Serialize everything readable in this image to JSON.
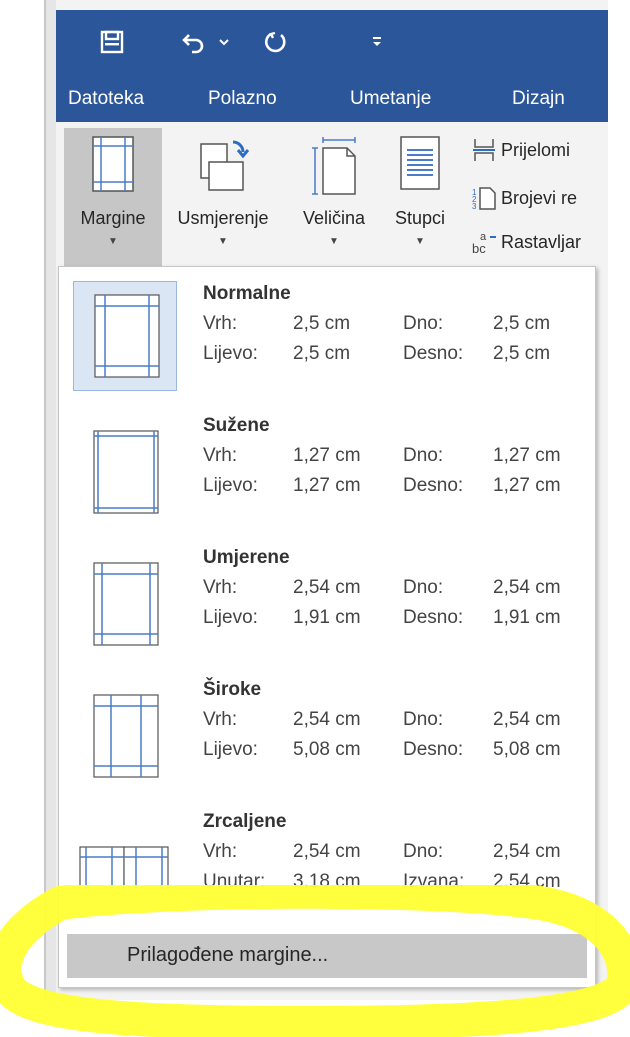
{
  "quick_access": {
    "save_icon": "save-icon",
    "undo_icon": "undo-icon",
    "undo_dropdown_icon": "chevron-down-icon",
    "redo_icon": "redo-icon",
    "customize_icon": "customize-qat-icon"
  },
  "tabs": [
    "Datoteka",
    "Polazno",
    "Umetanje",
    "Dizajn"
  ],
  "ribbon": {
    "margins_label": "Margine",
    "orientation_label": "Usmjerenje",
    "size_label": "Veličina",
    "columns_label": "Stupci",
    "breaks_label": "Prijelomi",
    "line_numbers_label": "Brojevi re",
    "hyphenation_label": "Rastavljar"
  },
  "margins_menu": {
    "options": [
      {
        "name": "Normalne",
        "k1": "Vrh:",
        "v1": "2,5 cm",
        "k2": "Dno:",
        "v2": "2,5 cm",
        "k3": "Lijevo:",
        "v3": "2,5 cm",
        "k4": "Desno:",
        "v4": "2,5 cm"
      },
      {
        "name": "Sužene",
        "k1": "Vrh:",
        "v1": "1,27 cm",
        "k2": "Dno:",
        "v2": "1,27 cm",
        "k3": "Lijevo:",
        "v3": "1,27 cm",
        "k4": "Desno:",
        "v4": "1,27 cm"
      },
      {
        "name": "Umjerene",
        "k1": "Vrh:",
        "v1": "2,54 cm",
        "k2": "Dno:",
        "v2": "2,54 cm",
        "k3": "Lijevo:",
        "v3": "1,91 cm",
        "k4": "Desno:",
        "v4": "1,91 cm"
      },
      {
        "name": "Široke",
        "k1": "Vrh:",
        "v1": "2,54 cm",
        "k2": "Dno:",
        "v2": "2,54 cm",
        "k3": "Lijevo:",
        "v3": "5,08 cm",
        "k4": "Desno:",
        "v4": "5,08 cm"
      },
      {
        "name": "Zrcaljene",
        "k1": "Vrh:",
        "v1": "2,54 cm",
        "k2": "Dno:",
        "v2": "2,54 cm",
        "k3": "Unutar:",
        "v3": "3,18 cm",
        "k4": "Izvana:",
        "v4": "2,54 cm"
      }
    ],
    "custom_label": "Prilagođene margine..."
  },
  "colors": {
    "title_bar": "#2b579a",
    "highlighter": "#ffff33",
    "margin_line": "#4a7cc9"
  }
}
